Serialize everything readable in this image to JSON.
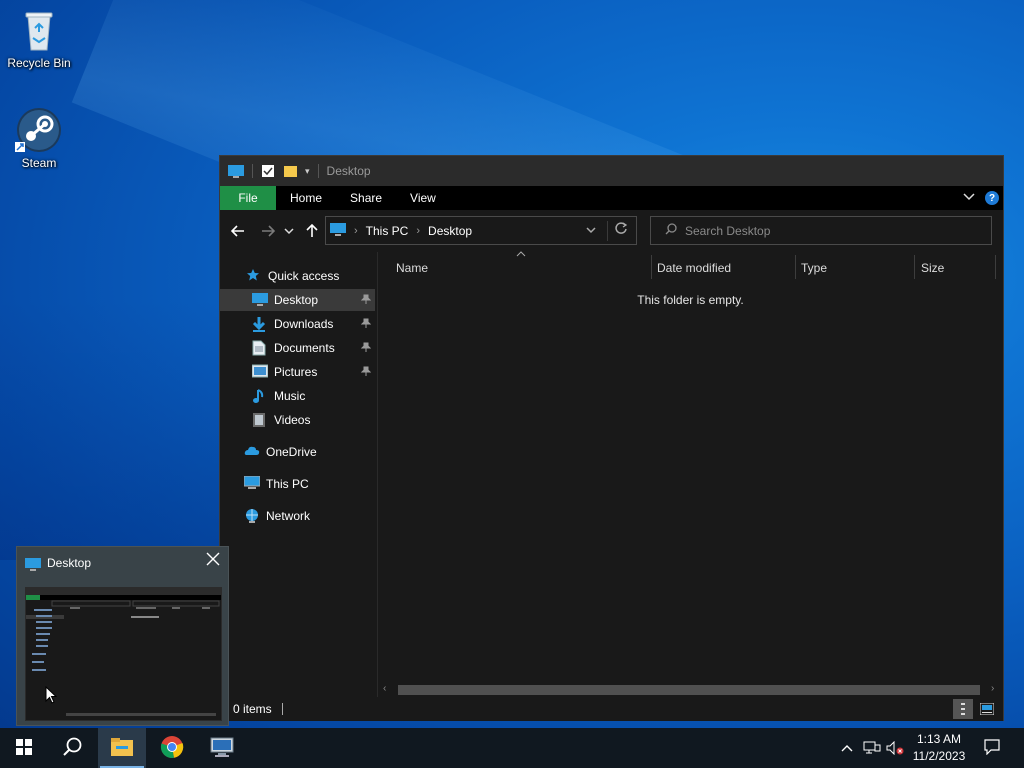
{
  "desktop": {
    "icons": [
      {
        "label": "Recycle Bin",
        "icon": "recycle-bin-icon"
      },
      {
        "label": "Steam",
        "icon": "steam-icon"
      }
    ]
  },
  "explorer": {
    "title": "Desktop",
    "ribbon_tabs": [
      "File",
      "Home",
      "Share",
      "View"
    ],
    "help_label": "?",
    "address": {
      "segments": [
        "This PC",
        "Desktop"
      ]
    },
    "search": {
      "placeholder": "Search Desktop"
    },
    "nav": {
      "quick_access": "Quick access",
      "items": [
        {
          "label": "Desktop",
          "pinned": true,
          "selected": true,
          "icon": "desktop-icon"
        },
        {
          "label": "Downloads",
          "pinned": true,
          "icon": "downloads-icon"
        },
        {
          "label": "Documents",
          "pinned": true,
          "icon": "documents-icon"
        },
        {
          "label": "Pictures",
          "pinned": true,
          "icon": "pictures-icon"
        },
        {
          "label": "Music",
          "pinned": false,
          "icon": "music-icon"
        },
        {
          "label": "Videos",
          "pinned": false,
          "icon": "videos-icon"
        }
      ],
      "onedrive": "OneDrive",
      "this_pc": "This PC",
      "network": "Network"
    },
    "columns": [
      "Name",
      "Date modified",
      "Type",
      "Size"
    ],
    "empty_message": "This folder is empty.",
    "status": "0 items"
  },
  "thumbnail": {
    "title": "Desktop"
  },
  "taskbar": {
    "time": "1:13 AM",
    "date": "11/2/2023",
    "apps": [
      "start",
      "search",
      "file-explorer",
      "chrome",
      "remote-desktop"
    ]
  },
  "colors": {
    "file_tab": "#1f8f46",
    "accent": "#1e7ad6",
    "window_bg": "#191919"
  }
}
